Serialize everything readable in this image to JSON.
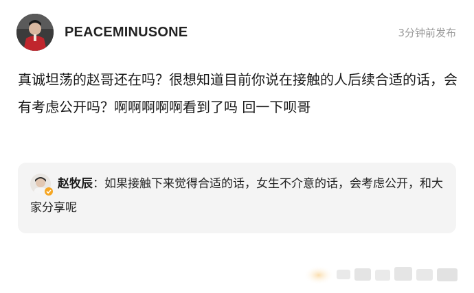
{
  "post": {
    "username": "PEACEMINUSONE",
    "timestamp": "3分钟前发布",
    "body": "真诚坦荡的赵哥还在吗？很想知道目前你说在接触的人后续合适的话，会有考虑公开吗？啊啊啊啊啊看到了吗 回一下呗哥"
  },
  "reply": {
    "author": "赵牧辰",
    "separator": "：",
    "text": "如果接触下来觉得合适的话，女生不介意的话，会考虑公开，和大家分享呢"
  },
  "colors": {
    "verified_badge": "#f5a623",
    "reply_bg": "#f4f4f4",
    "timestamp": "#9a9a9a"
  }
}
